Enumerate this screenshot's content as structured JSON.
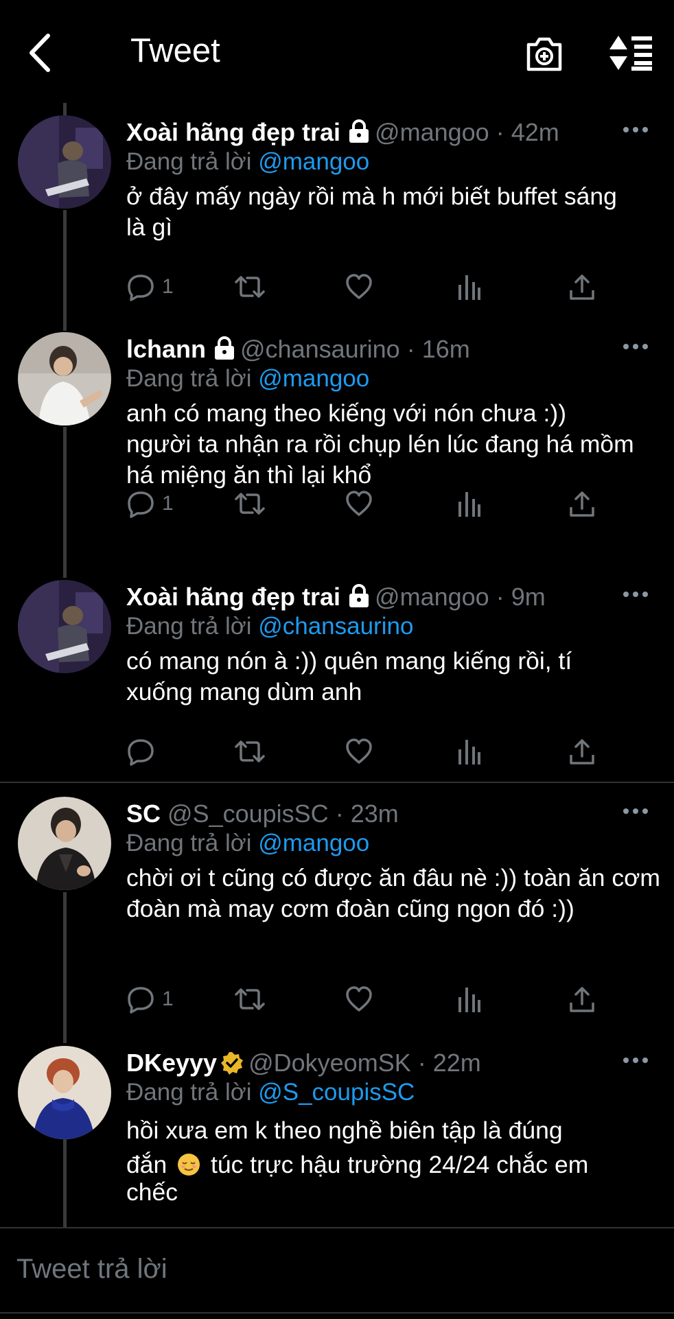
{
  "header": {
    "title": "Tweet",
    "back_icon": "chevron-left-icon",
    "camera_icon": "camera-add-icon",
    "sort_icon": "sort-icon"
  },
  "tweets": [
    {
      "name": "Xoài hãng đẹp trai",
      "protected": true,
      "handle": "@mangoo",
      "dot": "·",
      "time": "42m",
      "reply_label": "Đang trả lời",
      "reply_to": "@mangoo",
      "text": "ở đây mấy ngày rồi mà h mới biết buffet sáng là gì",
      "reply_count": "1"
    },
    {
      "name": "lchann",
      "protected": true,
      "handle": "@chansaurino",
      "dot": "·",
      "time": "16m",
      "reply_label": "Đang trả lời",
      "reply_to": "@mangoo",
      "text": "anh có mang theo kiếng với nón chưa :)) người ta nhận ra rồi chụp lén lúc đang há mồm há miệng ăn thì lại khổ",
      "reply_count": "1"
    },
    {
      "name": "Xoài hãng đẹp trai",
      "protected": true,
      "handle": "@mangoo",
      "dot": "·",
      "time": "9m",
      "reply_label": "Đang trả lời",
      "reply_to": "@chansaurino",
      "text": "có mang nón à :)) quên mang kiếng rồi, tí xuống mang dùm anh",
      "reply_count": ""
    },
    {
      "name": "SC",
      "protected": false,
      "handle": "@S_coupisSC",
      "dot": "·",
      "time": "23m",
      "reply_label": "Đang trả lời",
      "reply_to": "@mangoo",
      "text": "chời ơi t cũng có được ăn đâu nè :)) toàn ăn cơm đoàn mà may cơm đoàn cũng ngon đó :))",
      "reply_count": "1"
    },
    {
      "name": "DKeyyy",
      "verified": true,
      "handle": "@DokyeomSK",
      "dot": "·",
      "time": "22m",
      "reply_label": "Đang trả lời",
      "reply_to": "@S_coupisSC",
      "text_line1": "hồi xưa em k theo nghề biên tập là đúng",
      "text_line2a": "đắn",
      "text_line2b": "túc trực hậu trường 24/24 chắc em",
      "text_line3": "chếc"
    }
  ],
  "composer": {
    "placeholder": "Tweet trả lời"
  },
  "colors": {
    "background": "#000000",
    "link": "#1d9bf0",
    "muted": "#71767b",
    "divider": "#2f3336",
    "verified": "#e8b628"
  }
}
